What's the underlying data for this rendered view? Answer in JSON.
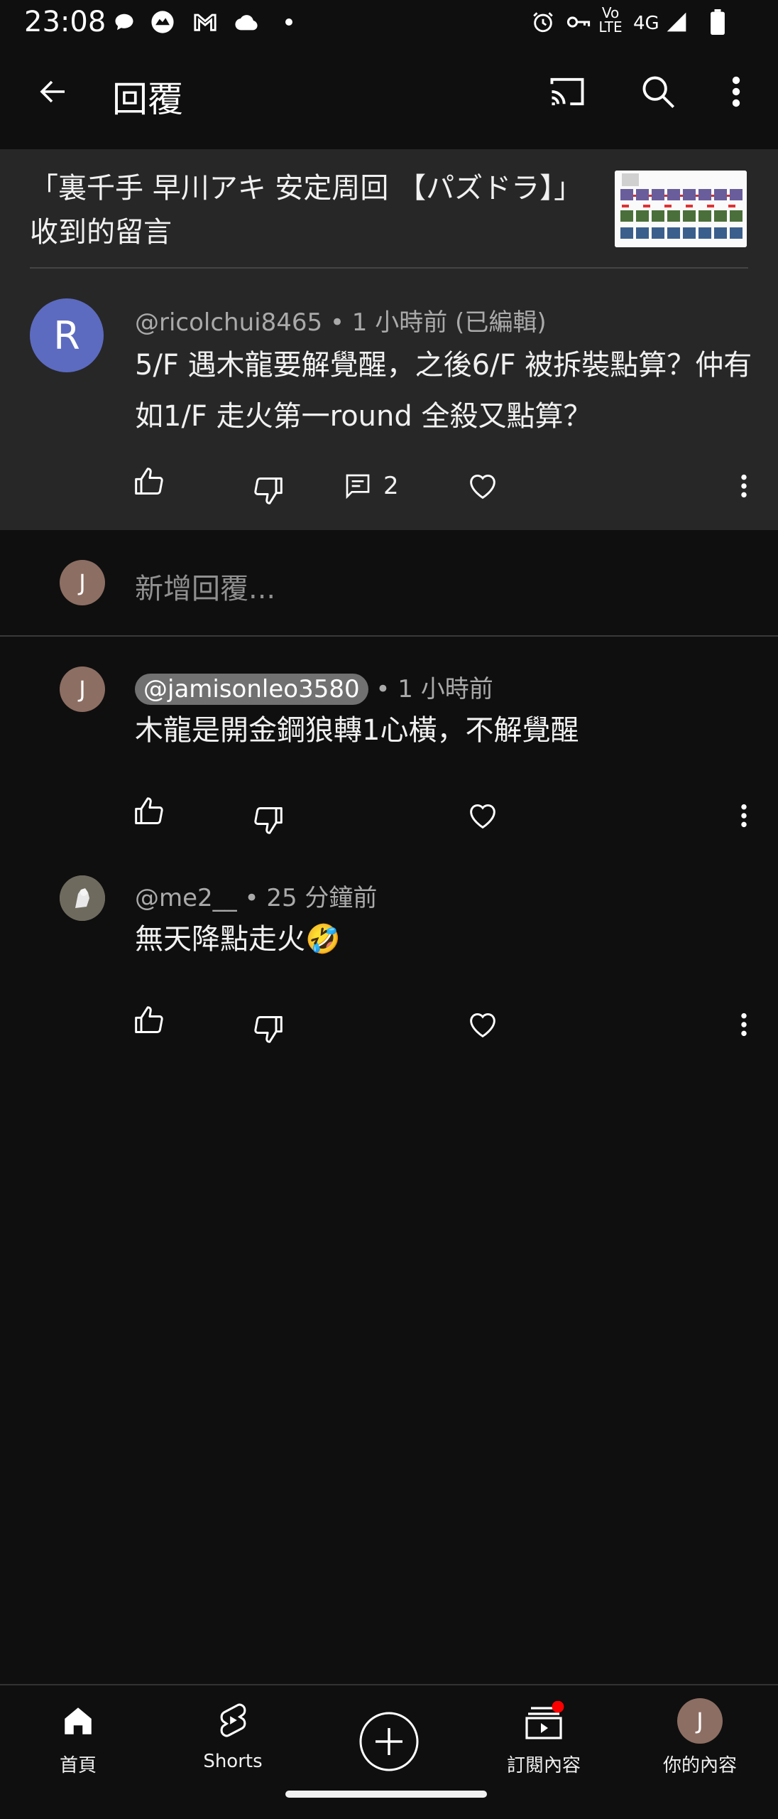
{
  "status_bar": {
    "time": "23:08",
    "network": "4G",
    "volte": "Vo LTE",
    "icons": [
      "chat-bubble-icon",
      "face-app-icon",
      "gmail-icon",
      "cloud-icon",
      "dot-icon",
      "alarm-icon",
      "vpn-key-icon",
      "signal-icon",
      "battery-icon"
    ]
  },
  "app_bar": {
    "title": "回覆",
    "icons": [
      "back-arrow-icon",
      "cast-icon",
      "search-icon",
      "more-vert-icon"
    ]
  },
  "video_header": {
    "text": "「裏千手  早川アキ 安定周回 【パズドラ】」收到的留言"
  },
  "parent_comment": {
    "avatar_letter": "R",
    "avatar_color": "#5c6bc0",
    "handle": "@ricolchui8465",
    "time": " • 1 小時前 (已編輯)",
    "text": "5/F 遇木龍要解覺醒，之後6/F 被拆裝點算？仲有如1/F 走火第一round 全殺又點算？",
    "reply_count": "2"
  },
  "add_reply": {
    "avatar_letter": "J",
    "placeholder": "新增回覆..."
  },
  "replies": [
    {
      "avatar_letter": "J",
      "handle": "@jamisonleo3580",
      "time": " • 1 小時前",
      "text": "木龍是開金鋼狼轉1心橫，不解覺醒"
    },
    {
      "handle": "@me2__",
      "time": " • 25 分鐘前",
      "text": "無天降點走火🤣"
    }
  ],
  "bottom_nav": {
    "items": [
      {
        "label": "首頁",
        "icon": "home-icon"
      },
      {
        "label": "Shorts",
        "icon": "shorts-icon"
      },
      {
        "label": "",
        "icon": "create-plus-icon"
      },
      {
        "label": "訂閱內容",
        "icon": "subscriptions-icon"
      },
      {
        "label": "你的內容",
        "icon": "account-avatar-icon"
      }
    ],
    "avatar_letter": "J"
  },
  "colors": {
    "background": "#0f0f0f",
    "surface": "#272727",
    "text_primary": "#f1f1f1",
    "text_secondary": "#aaaaaa",
    "notification": "#ff0000"
  }
}
